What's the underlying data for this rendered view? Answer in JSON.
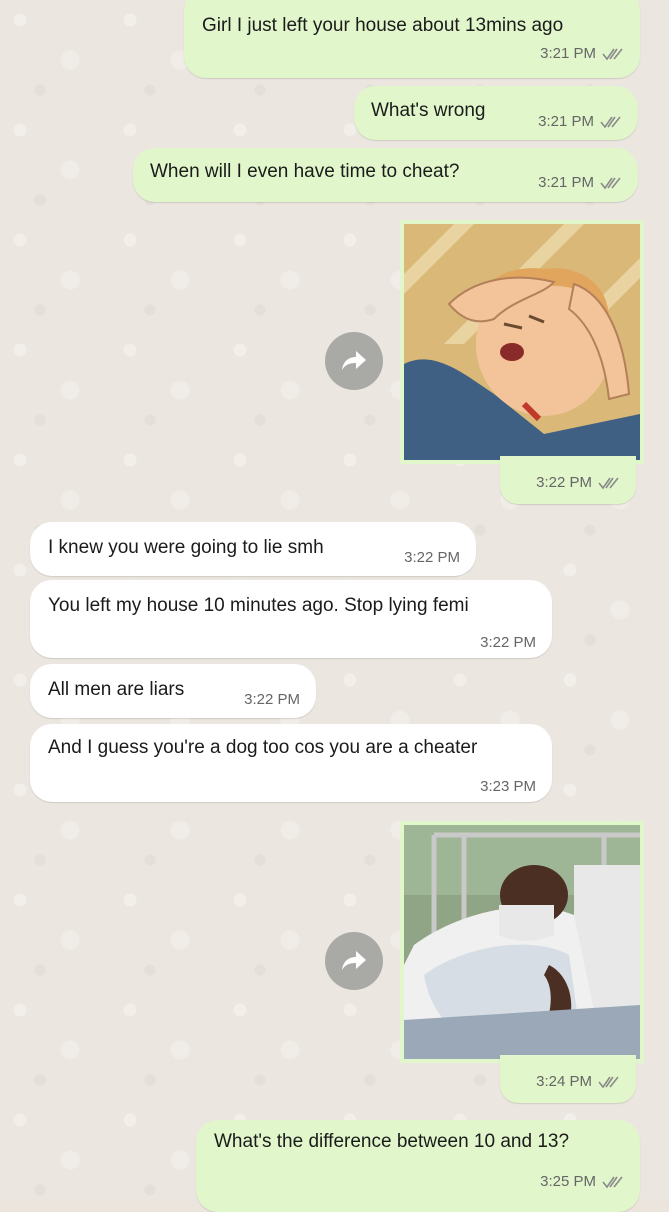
{
  "messages": [
    {
      "text": "Girl I just left your house about 13mins ago",
      "time": "3:21 PM"
    },
    {
      "text": "What's wrong",
      "time": "3:21 PM"
    },
    {
      "text": "When will I even have time to cheat?",
      "time": "3:21 PM"
    },
    {
      "image": "king-of-the-hill-stressed-meme",
      "time": "3:22 PM"
    },
    {
      "text": "I knew you were going to lie smh",
      "time": "3:22 PM"
    },
    {
      "text": "You left my house 10 minutes ago. Stop lying femi",
      "time": "3:22 PM"
    },
    {
      "text": "All men are liars",
      "time": "3:22 PM"
    },
    {
      "text": "And I guess you're a dog too cos you are a cheater",
      "time": "3:23 PM"
    },
    {
      "image": "boy-in-hospital-bed-meme",
      "time": "3:24 PM"
    },
    {
      "text": "What's the difference between 10 and 13?",
      "time": "3:25 PM"
    }
  ],
  "colors": {
    "outgoing_bubble": "#e1f7cb",
    "incoming_bubble": "#ffffff",
    "wallpaper": "#ebe6df",
    "forward_button": "#a9a9a6",
    "read_ticks": "#8a8a8a"
  },
  "icons": [
    "forward-icon",
    "read-receipt-icon"
  ]
}
